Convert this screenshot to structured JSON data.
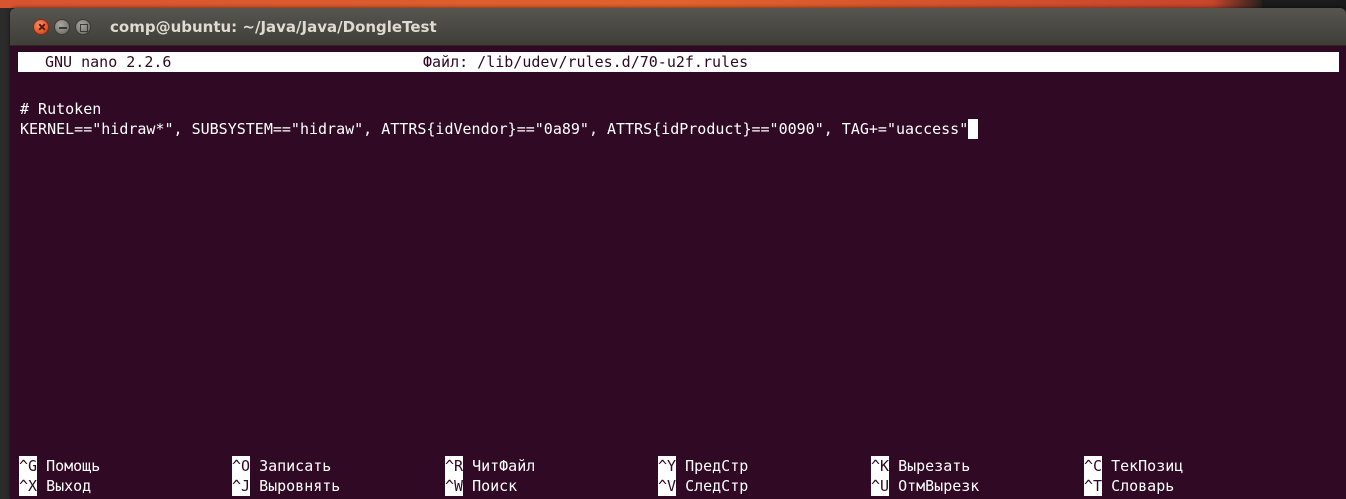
{
  "window": {
    "title": "comp@ubuntu: ~/Java/Java/DongleTest"
  },
  "nano": {
    "version": "GNU nano 2.2.6",
    "file_label": "Файл: /lib/udev/rules.d/70-u2f.rules"
  },
  "content": {
    "lines": [
      "# Rutoken",
      "KERNEL==\"hidraw*\", SUBSYSTEM==\"hidraw\", ATTRS{idVendor}==\"0a89\", ATTRS{idProduct}==\"0090\", TAG+=\"uaccess\""
    ]
  },
  "shortcuts": {
    "row1": [
      {
        "key": "^G",
        "label": "Помощь"
      },
      {
        "key": "^O",
        "label": "Записать"
      },
      {
        "key": "^R",
        "label": "ЧитФайл"
      },
      {
        "key": "^Y",
        "label": "ПредСтр"
      },
      {
        "key": "^K",
        "label": "Вырезать"
      },
      {
        "key": "^C",
        "label": "ТекПозиц"
      }
    ],
    "row2": [
      {
        "key": "^X",
        "label": "Выход"
      },
      {
        "key": "^J",
        "label": "Выровнять"
      },
      {
        "key": "^W",
        "label": "Поиск"
      },
      {
        "key": "^V",
        "label": "СледСтр"
      },
      {
        "key": "^U",
        "label": "ОтмВырезк"
      },
      {
        "key": "^T",
        "label": "Словарь"
      }
    ]
  },
  "colors": {
    "terminal_bg": "#300a24",
    "terminal_fg": "#ffffff",
    "titlebar": "#4a4944",
    "close_button": "#e4572b"
  },
  "icons": [
    "close-icon",
    "minimize-icon",
    "maximize-icon"
  ]
}
